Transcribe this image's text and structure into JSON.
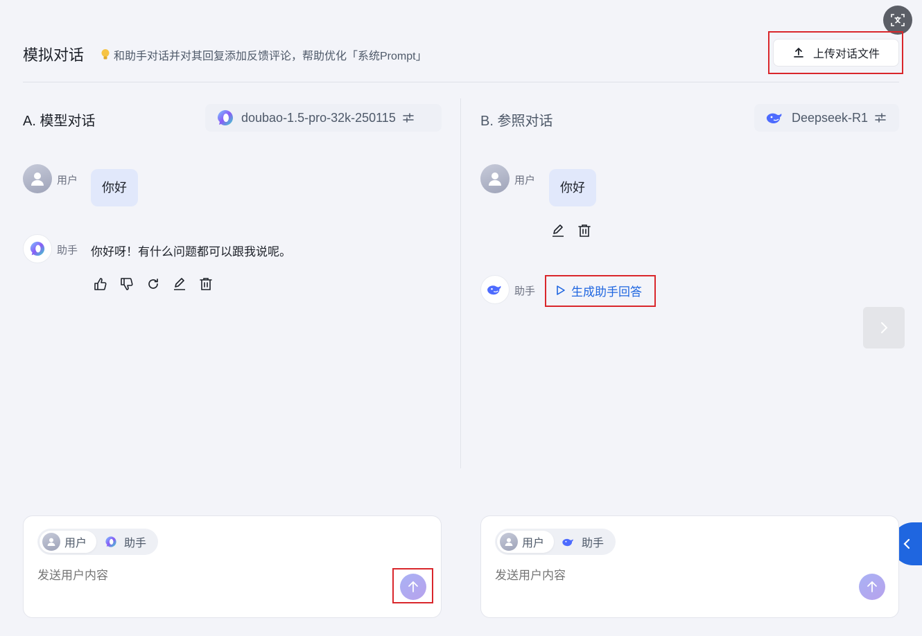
{
  "header": {
    "title": "模拟对话",
    "tip": "和助手对话并对其回复添加反馈评论，帮助优化「系统Prompt」",
    "upload_label": "上传对话文件"
  },
  "panel_a": {
    "title": "A. 模型对话",
    "model_name": "doubao-1.5-pro-32k-250115",
    "user_label": "用户",
    "user_message": "你好",
    "assistant_label": "助手",
    "assistant_message": "你好呀！有什么问题都可以跟我说呢。"
  },
  "panel_b": {
    "title": "B. 参照对话",
    "model_name": "Deepseek-R1",
    "user_label": "用户",
    "user_message": "你好",
    "assistant_label": "助手",
    "generate_label": "生成助手回答"
  },
  "input_a": {
    "role_user": "用户",
    "role_assistant": "助手",
    "placeholder": "发送用户内容"
  },
  "input_b": {
    "role_user": "用户",
    "role_assistant": "助手",
    "placeholder": "发送用户内容"
  },
  "colors": {
    "accent": "#1f66e0",
    "highlight_box": "#d9262b",
    "user_bubble": "#e1e8fb"
  }
}
